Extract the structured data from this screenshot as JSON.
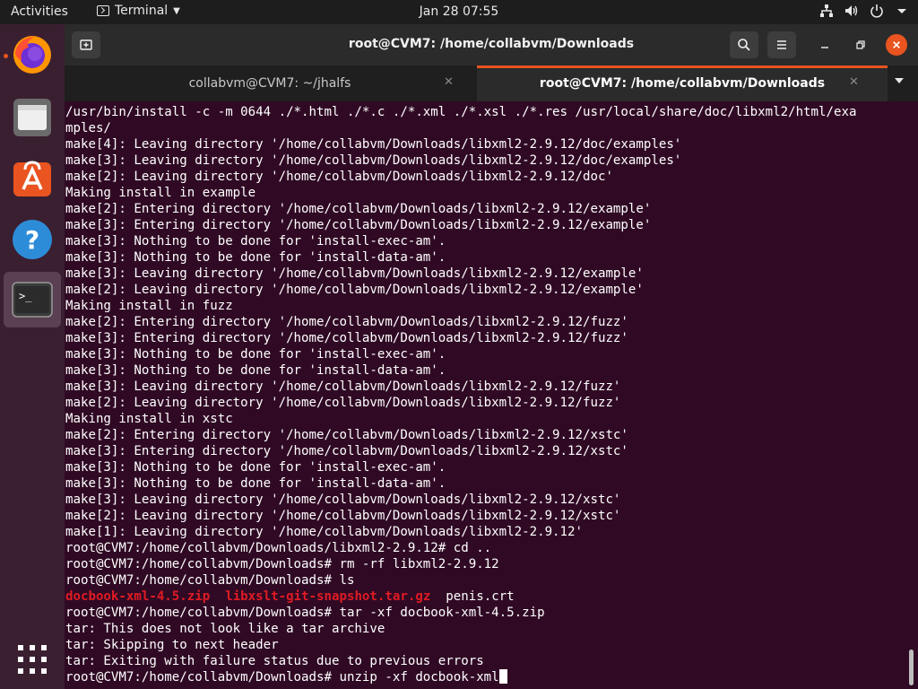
{
  "topbar": {
    "activities": "Activities",
    "app_name": "Terminal",
    "clock": "Jan 28  07:55"
  },
  "window": {
    "title": "root@CVM7: /home/collabvm/Downloads",
    "tabs": [
      {
        "label": "collabvm@CVM7: ~/jhalfs",
        "active": false
      },
      {
        "label": "root@CVM7: /home/collabvm/Downloads",
        "active": true
      }
    ]
  },
  "terminal": {
    "lines": [
      "/usr/bin/install -c -m 0644 ./*.html ./*.c ./*.xml ./*.xsl ./*.res /usr/local/share/doc/libxml2/html/exa",
      "mples/",
      "make[4]: Leaving directory '/home/collabvm/Downloads/libxml2-2.9.12/doc/examples'",
      "make[3]: Leaving directory '/home/collabvm/Downloads/libxml2-2.9.12/doc/examples'",
      "make[2]: Leaving directory '/home/collabvm/Downloads/libxml2-2.9.12/doc'",
      "Making install in example",
      "make[2]: Entering directory '/home/collabvm/Downloads/libxml2-2.9.12/example'",
      "make[3]: Entering directory '/home/collabvm/Downloads/libxml2-2.9.12/example'",
      "make[3]: Nothing to be done for 'install-exec-am'.",
      "make[3]: Nothing to be done for 'install-data-am'.",
      "make[3]: Leaving directory '/home/collabvm/Downloads/libxml2-2.9.12/example'",
      "make[2]: Leaving directory '/home/collabvm/Downloads/libxml2-2.9.12/example'",
      "Making install in fuzz",
      "make[2]: Entering directory '/home/collabvm/Downloads/libxml2-2.9.12/fuzz'",
      "make[3]: Entering directory '/home/collabvm/Downloads/libxml2-2.9.12/fuzz'",
      "make[3]: Nothing to be done for 'install-exec-am'.",
      "make[3]: Nothing to be done for 'install-data-am'.",
      "make[3]: Leaving directory '/home/collabvm/Downloads/libxml2-2.9.12/fuzz'",
      "make[2]: Leaving directory '/home/collabvm/Downloads/libxml2-2.9.12/fuzz'",
      "Making install in xstc",
      "make[2]: Entering directory '/home/collabvm/Downloads/libxml2-2.9.12/xstc'",
      "make[3]: Entering directory '/home/collabvm/Downloads/libxml2-2.9.12/xstc'",
      "make[3]: Nothing to be done for 'install-exec-am'.",
      "make[3]: Nothing to be done for 'install-data-am'.",
      "make[3]: Leaving directory '/home/collabvm/Downloads/libxml2-2.9.12/xstc'",
      "make[2]: Leaving directory '/home/collabvm/Downloads/libxml2-2.9.12/xstc'",
      "make[1]: Leaving directory '/home/collabvm/Downloads/libxml2-2.9.12'",
      "root@CVM7:/home/collabvm/Downloads/libxml2-2.9.12# cd ..",
      "root@CVM7:/home/collabvm/Downloads# rm -rf libxml2-2.9.12",
      "root@CVM7:/home/collabvm/Downloads# ls"
    ],
    "ls_output": {
      "red_items": [
        "docbook-xml-4.5.zip",
        "libxslt-git-snapshot.tar.gz"
      ],
      "plain_items": [
        "penis.crt"
      ]
    },
    "lines_after": [
      "root@CVM7:/home/collabvm/Downloads# tar -xf docbook-xml-4.5.zip",
      "tar: This does not look like a tar archive",
      "tar: Skipping to next header",
      "tar: Exiting with failure status due to previous errors"
    ],
    "current_prompt": "root@CVM7:/home/collabvm/Downloads# ",
    "current_input": "unzip -xf docbook-xml"
  },
  "colors": {
    "terminal_bg": "#300a24",
    "accent": "#e95420",
    "ls_red": "#e01b24"
  },
  "icons": {
    "dock": [
      "firefox-icon",
      "files-icon",
      "software-icon",
      "help-icon",
      "terminal-icon",
      "show-apps-icon"
    ],
    "tray": [
      "network-icon",
      "volume-icon",
      "power-icon",
      "chevron-down-icon"
    ]
  }
}
